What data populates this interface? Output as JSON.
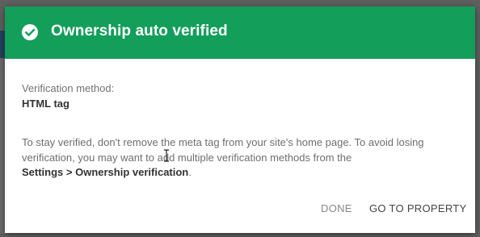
{
  "dialog": {
    "title": "Ownership auto verified",
    "header_color": "#139e5a",
    "icon": "check-circle-icon"
  },
  "verification": {
    "method_label": "Verification method:",
    "method_value": "HTML tag"
  },
  "message": {
    "line1": "To stay verified, don't remove the meta tag from your site's home page. To avoid losing",
    "line2": "verification, you may want to add multiple verification methods from the",
    "settings_path": "Settings > Ownership verification",
    "period": "."
  },
  "actions": {
    "done_label": "DONE",
    "go_label": "GO TO PROPERTY"
  }
}
